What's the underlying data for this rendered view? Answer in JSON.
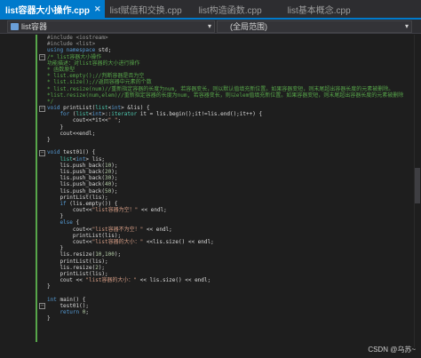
{
  "tabs": [
    {
      "label": "list容器大小操作.cpp",
      "active": true,
      "close": "✕"
    },
    {
      "label": "list赋值和交换.cpp",
      "active": false,
      "close": "✕"
    },
    {
      "label": "list构造函数.cpp",
      "active": false,
      "close": "✕"
    },
    {
      "label": "list基本概念.cpp",
      "active": false,
      "close": "✕"
    }
  ],
  "nav": {
    "scope": "list容器",
    "member": "(全局范围)"
  },
  "code_lines": [
    [
      [
        "pp",
        "#include <iostream>"
      ]
    ],
    [
      [
        "pp",
        "#include <list>"
      ]
    ],
    [
      [
        "kw",
        "using namespace "
      ],
      [
        "",
        "std;"
      ]
    ],
    [
      [
        "cm",
        "/* list容器大小操作"
      ]
    ],
    [
      [
        "cm",
        "功能描述：对list容器的大小进行操作"
      ]
    ],
    [
      [
        "cm",
        "* 函数原型"
      ]
    ],
    [
      [
        "cm",
        "* list.empty();//判断容器是否为空"
      ]
    ],
    [
      [
        "cm",
        "* list.size();//返回容器中元素的个数"
      ]
    ],
    [
      [
        "cm",
        "* list.resize(num)//重新指定容器的长度为num, 若容器变长，则以默认值填充新位置。如果容器变短，则末尾超出容器长度的元素被删除。"
      ]
    ],
    [
      [
        "cm",
        "*list.resize(num,elem)//重新指定容器的长度为num, 若容器变长，则以elem值填充新位置。如果容器变短，则末尾超出容器长度的元素被删除"
      ]
    ],
    [
      [
        "cm",
        "*/"
      ]
    ],
    [
      [
        "kw",
        "void "
      ],
      [
        "",
        "printList("
      ],
      [
        "ty",
        "list"
      ],
      [
        "",
        "<"
      ],
      [
        "kw",
        "int"
      ],
      [
        "",
        "> &lis) {"
      ]
    ],
    [
      [
        "",
        ""
      ],
      [
        "kw",
        "    for "
      ],
      [
        "",
        "("
      ],
      [
        "ty",
        "list"
      ],
      [
        "",
        "<"
      ],
      [
        "kw",
        "int"
      ],
      [
        "",
        ">::"
      ],
      [
        "ty",
        "iterator"
      ],
      [
        "",
        " it = lis.begin();it!=lis.end();it++) {"
      ]
    ],
    [
      [
        "",
        "        cout<<*it<<"
      ],
      [
        "st",
        "\" \""
      ],
      [
        "",
        ";"
      ]
    ],
    [
      [
        "",
        "    }"
      ]
    ],
    [
      [
        "",
        "    cout<<endl;"
      ]
    ],
    [
      [
        "",
        "}"
      ]
    ],
    [
      [
        "",
        ""
      ]
    ],
    [
      [
        "kw",
        "void "
      ],
      [
        "",
        "test01() {"
      ]
    ],
    [
      [
        "ty",
        "    list"
      ],
      [
        "",
        "<"
      ],
      [
        "kw",
        "int"
      ],
      [
        "",
        "> lis;"
      ]
    ],
    [
      [
        "",
        "    lis.push_back("
      ],
      [
        "nm",
        "10"
      ],
      [
        "",
        ");"
      ]
    ],
    [
      [
        "",
        "    lis.push_back("
      ],
      [
        "nm",
        "20"
      ],
      [
        "",
        ");"
      ]
    ],
    [
      [
        "",
        "    lis.push_back("
      ],
      [
        "nm",
        "30"
      ],
      [
        "",
        ");"
      ]
    ],
    [
      [
        "",
        "    lis.push_back("
      ],
      [
        "nm",
        "40"
      ],
      [
        "",
        ");"
      ]
    ],
    [
      [
        "",
        "    lis.push_back("
      ],
      [
        "nm",
        "50"
      ],
      [
        "",
        ");"
      ]
    ],
    [
      [
        "",
        "    printList(lis);"
      ]
    ],
    [
      [
        "kw",
        "    if "
      ],
      [
        "",
        "(lis.empty()) {"
      ]
    ],
    [
      [
        "",
        "        cout<<"
      ],
      [
        "st",
        "\"list容器为空！\""
      ],
      [
        "",
        " << endl;"
      ]
    ],
    [
      [
        "",
        "    }"
      ]
    ],
    [
      [
        "kw",
        "    else "
      ],
      [
        "",
        "{"
      ]
    ],
    [
      [
        "",
        "        cout<<"
      ],
      [
        "st",
        "\"list容器不为空！\""
      ],
      [
        "",
        " << endl;"
      ]
    ],
    [
      [
        "",
        "        printList(lis);"
      ]
    ],
    [
      [
        "",
        "        cout<<"
      ],
      [
        "st",
        "\"list容器的大小：\""
      ],
      [
        "",
        " <<lis.size() << endl;"
      ]
    ],
    [
      [
        "",
        "    }"
      ]
    ],
    [
      [
        "",
        "    lis.resize("
      ],
      [
        "nm",
        "10"
      ],
      [
        "",
        ","
      ],
      [
        "nm",
        "100"
      ],
      [
        "",
        ");"
      ]
    ],
    [
      [
        "",
        "    printList(lis);"
      ]
    ],
    [
      [
        "",
        "    lis.resize("
      ],
      [
        "nm",
        "2"
      ],
      [
        "",
        ");"
      ]
    ],
    [
      [
        "",
        "    printList(lis);"
      ]
    ],
    [
      [
        "",
        "    cout << "
      ],
      [
        "st",
        "\"list容器的大小：\""
      ],
      [
        "",
        " << lis.size() << endl;"
      ]
    ],
    [
      [
        "",
        "}"
      ]
    ],
    [
      [
        "",
        ""
      ]
    ],
    [
      [
        "kw",
        "int "
      ],
      [
        "",
        "main() {"
      ]
    ],
    [
      [
        "",
        "    test01();"
      ]
    ],
    [
      [
        "kw",
        "    return "
      ],
      [
        "nm",
        "0"
      ],
      [
        "",
        ";"
      ]
    ],
    [
      [
        "",
        "}"
      ]
    ]
  ],
  "watermark": "CSDN @乌苏~"
}
